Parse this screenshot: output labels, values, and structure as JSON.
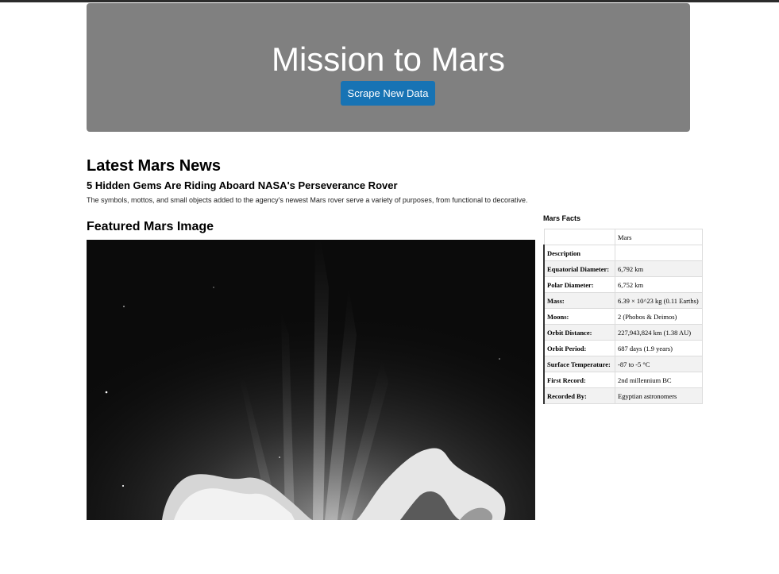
{
  "header": {
    "title": "Mission to Mars",
    "button_label": "Scrape New Data",
    "colors": {
      "jumbotron_bg": "#808080",
      "button_bg": "#1773b4"
    }
  },
  "news": {
    "heading": "Latest Mars News",
    "title": "5 Hidden Gems Are Riding Aboard NASA's Perseverance Rover",
    "paragraph": "The symbols, mottos, and small objects added to the agency's newest Mars rover serve a variety of purposes, from functional to decorative."
  },
  "featured_image": {
    "heading": "Featured Mars Image"
  },
  "facts": {
    "label": "Mars Facts",
    "column_header": "Mars",
    "rows": [
      {
        "key": "Description",
        "value": ""
      },
      {
        "key": "Equatorial Diameter:",
        "value": "6,792 km"
      },
      {
        "key": "Polar Diameter:",
        "value": "6,752 km"
      },
      {
        "key": "Mass:",
        "value": "6.39 × 10^23 kg (0.11 Earths)"
      },
      {
        "key": "Moons:",
        "value": "2 (Phobos & Deimos)"
      },
      {
        "key": "Orbit Distance:",
        "value": "227,943,824 km (1.38 AU)"
      },
      {
        "key": "Orbit Period:",
        "value": "687 days (1.9 years)"
      },
      {
        "key": "Surface Temperature:",
        "value": "-87 to -5 °C"
      },
      {
        "key": "First Record:",
        "value": "2nd millennium BC"
      },
      {
        "key": "Recorded By:",
        "value": "Egyptian astronomers"
      }
    ]
  }
}
